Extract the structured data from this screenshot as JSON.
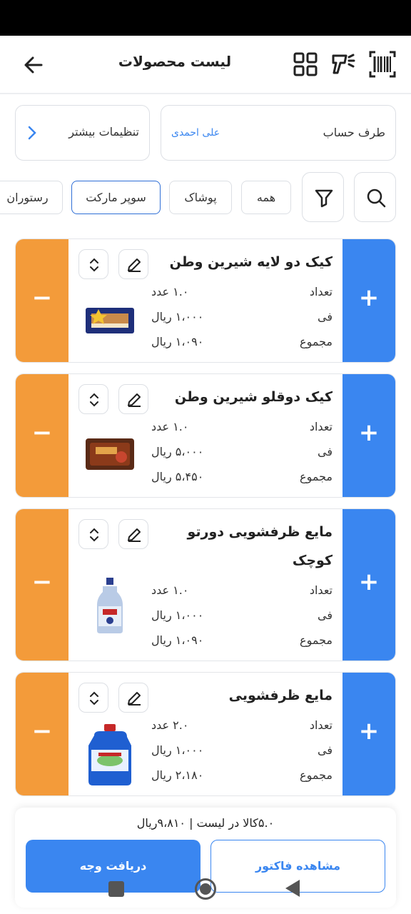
{
  "header": {
    "title": "لیست محصولات",
    "icons": [
      "back-arrow-icon",
      "grid-icon",
      "barcode-scanner-icon",
      "barcode-icon"
    ]
  },
  "account": {
    "label": "طرف حساب",
    "value": "علی احمدی"
  },
  "settings": {
    "label": "تنظیمات بیشتر"
  },
  "filters": {
    "chips": [
      "همه",
      "پوشاک",
      "سوپر مارکت",
      "رستوران"
    ],
    "selected": "سوپر مارکت"
  },
  "labels": {
    "count": "تعداد",
    "unit_price": "فی",
    "total": "مجموع"
  },
  "products": [
    {
      "name": "کیک دو لایه شیرین وطن",
      "count": "۱.۰ عدد",
      "price": "۱،۰۰۰ ریال",
      "total": "۱،۰۹۰ ریال"
    },
    {
      "name": "کیک دوقلو شیرین وطن",
      "count": "۱.۰ عدد",
      "price": "۵،۰۰۰ ریال",
      "total": "۵،۴۵۰ ریال"
    },
    {
      "name": "مایع ظرفشویی دورتو کوچک",
      "count": "۱.۰ عدد",
      "price": "۱،۰۰۰ ریال",
      "total": "۱،۰۹۰ ریال"
    },
    {
      "name": "مایع ظرفشویی",
      "count": "۲.۰ عدد",
      "price": "۱،۰۰۰ ریال",
      "total": "۲،۱۸۰ ریال"
    }
  ],
  "summary": {
    "text": "۵.۰کالا در لیست | ۹،۸۱۰ریال"
  },
  "actions": {
    "pay": "دریافت وجه",
    "invoice": "مشاهده فاکتور"
  },
  "colors": {
    "accent": "#3a86f0",
    "minus": "#f39b3a",
    "text": "#222222"
  }
}
